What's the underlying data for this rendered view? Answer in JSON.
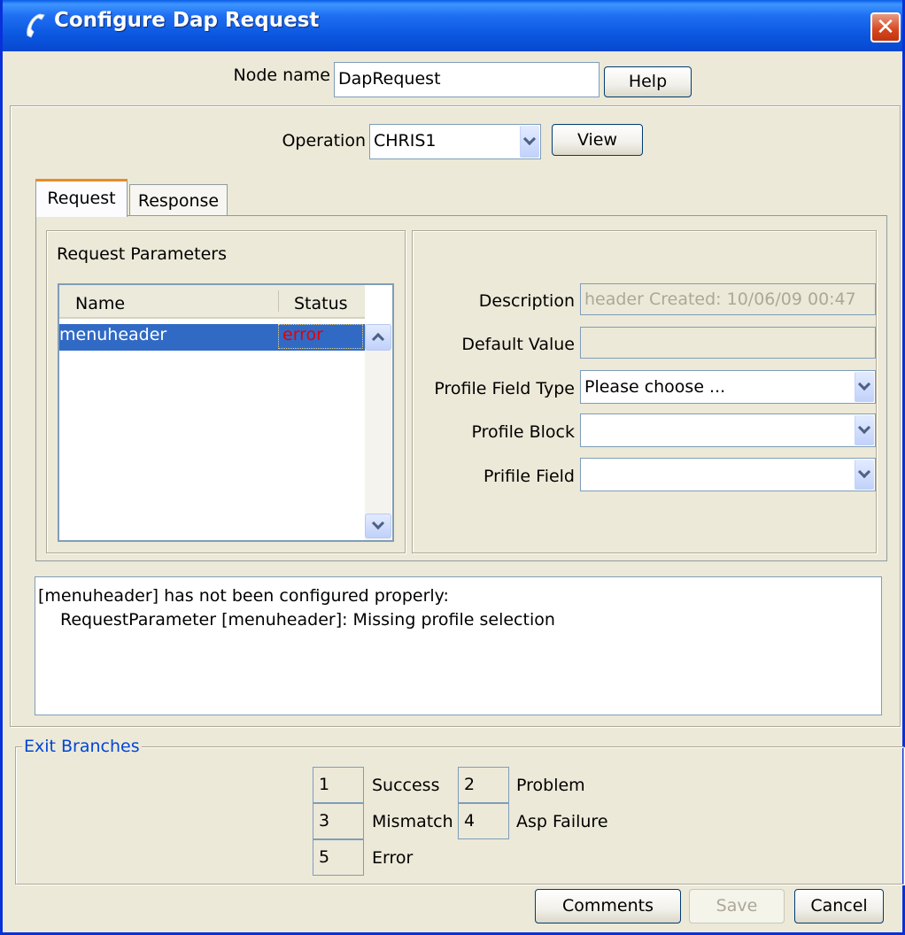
{
  "window": {
    "title": "Configure Dap Request"
  },
  "node": {
    "label": "Node name",
    "value": "DapRequest",
    "help_label": "Help"
  },
  "operation": {
    "label": "Operation",
    "selected": "CHRIS1",
    "view_label": "View"
  },
  "tabs": [
    {
      "label": "Request",
      "active": true
    },
    {
      "label": "Response",
      "active": false
    }
  ],
  "request_params": {
    "title": "Request Parameters",
    "columns": [
      "Name",
      "Status"
    ],
    "rows": [
      {
        "name": "menuheader",
        "status": "error"
      }
    ]
  },
  "details": {
    "description_label": "Description",
    "description_value": "header Created: 10/06/09 00:47",
    "default_value_label": "Default Value",
    "default_value": "",
    "profile_field_type_label": "Profile Field Type",
    "profile_field_type_value": "Please choose ...",
    "profile_block_label": "Profile Block",
    "profile_block_value": "",
    "prifile_field_label": "Prifile Field",
    "prifile_field_value": ""
  },
  "messages": {
    "line1": "[menuheader] has not been configured properly:",
    "line2": "RequestParameter [menuheader]: Missing profile selection"
  },
  "exit_branches": {
    "title": "Exit Branches",
    "items": [
      {
        "number": "1",
        "label": "Success"
      },
      {
        "number": "2",
        "label": "Problem"
      },
      {
        "number": "3",
        "label": "Mismatch"
      },
      {
        "number": "4",
        "label": "Asp Failure"
      },
      {
        "number": "5",
        "label": "Error"
      }
    ]
  },
  "footer": {
    "comments_label": "Comments",
    "save_label": "Save",
    "cancel_label": "Cancel"
  },
  "colors": {
    "titlebar": "#0a56df",
    "accent_tab": "#e68b2c",
    "error": "#e60000",
    "selection": "#316ac5",
    "group_title": "#0046d5"
  }
}
